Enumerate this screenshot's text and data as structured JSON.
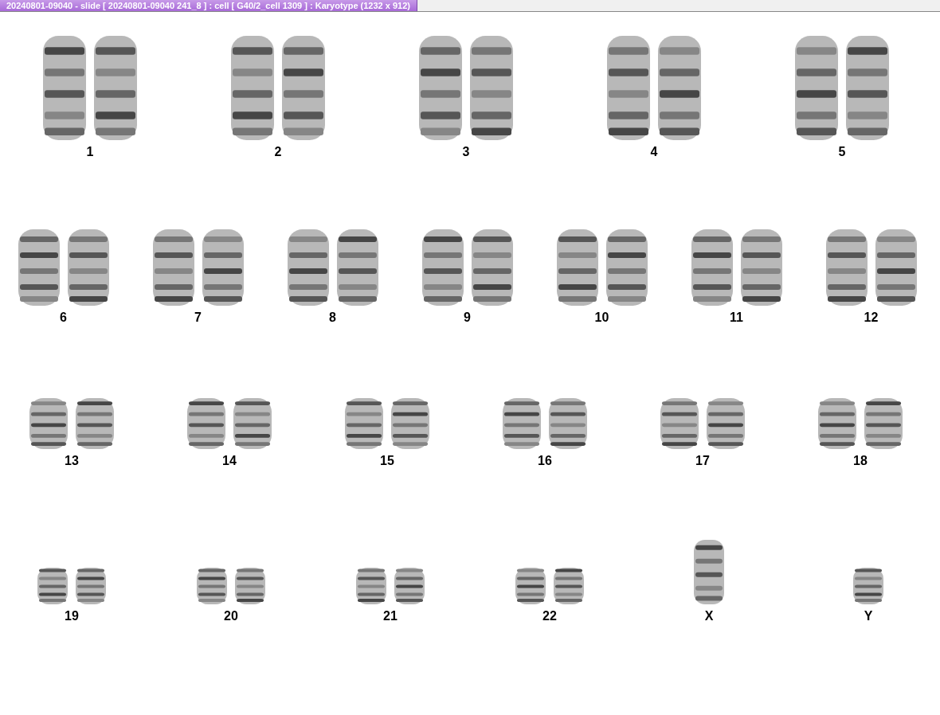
{
  "window": {
    "title": "20240801-09040 - slide [ 20240801-09040 241_8 ] : cell [ G40/2_cell 1309 ] : Karyotype  (1232 x 912)"
  },
  "karyotype_rows": [
    {
      "groups": [
        {
          "label": "1",
          "kind": "pair"
        },
        {
          "label": "2",
          "kind": "pair"
        },
        {
          "label": "3",
          "kind": "pair"
        },
        {
          "label": "4",
          "kind": "pair"
        },
        {
          "label": "5",
          "kind": "pair"
        }
      ]
    },
    {
      "groups": [
        {
          "label": "6",
          "kind": "pair"
        },
        {
          "label": "7",
          "kind": "pair"
        },
        {
          "label": "8",
          "kind": "pair"
        },
        {
          "label": "9",
          "kind": "pair"
        },
        {
          "label": "10",
          "kind": "pair"
        },
        {
          "label": "11",
          "kind": "pair"
        },
        {
          "label": "12",
          "kind": "pair"
        }
      ]
    },
    {
      "groups": [
        {
          "label": "13",
          "kind": "pair"
        },
        {
          "label": "14",
          "kind": "pair"
        },
        {
          "label": "15",
          "kind": "pair"
        },
        {
          "label": "16",
          "kind": "pair"
        },
        {
          "label": "17",
          "kind": "pair"
        },
        {
          "label": "18",
          "kind": "pair"
        }
      ]
    },
    {
      "groups": [
        {
          "label": "19",
          "kind": "pair"
        },
        {
          "label": "20",
          "kind": "pair"
        },
        {
          "label": "21",
          "kind": "pair"
        },
        {
          "label": "22",
          "kind": "pair"
        },
        {
          "label": "X",
          "kind": "single"
        },
        {
          "label": "Y",
          "kind": "single"
        }
      ]
    }
  ]
}
